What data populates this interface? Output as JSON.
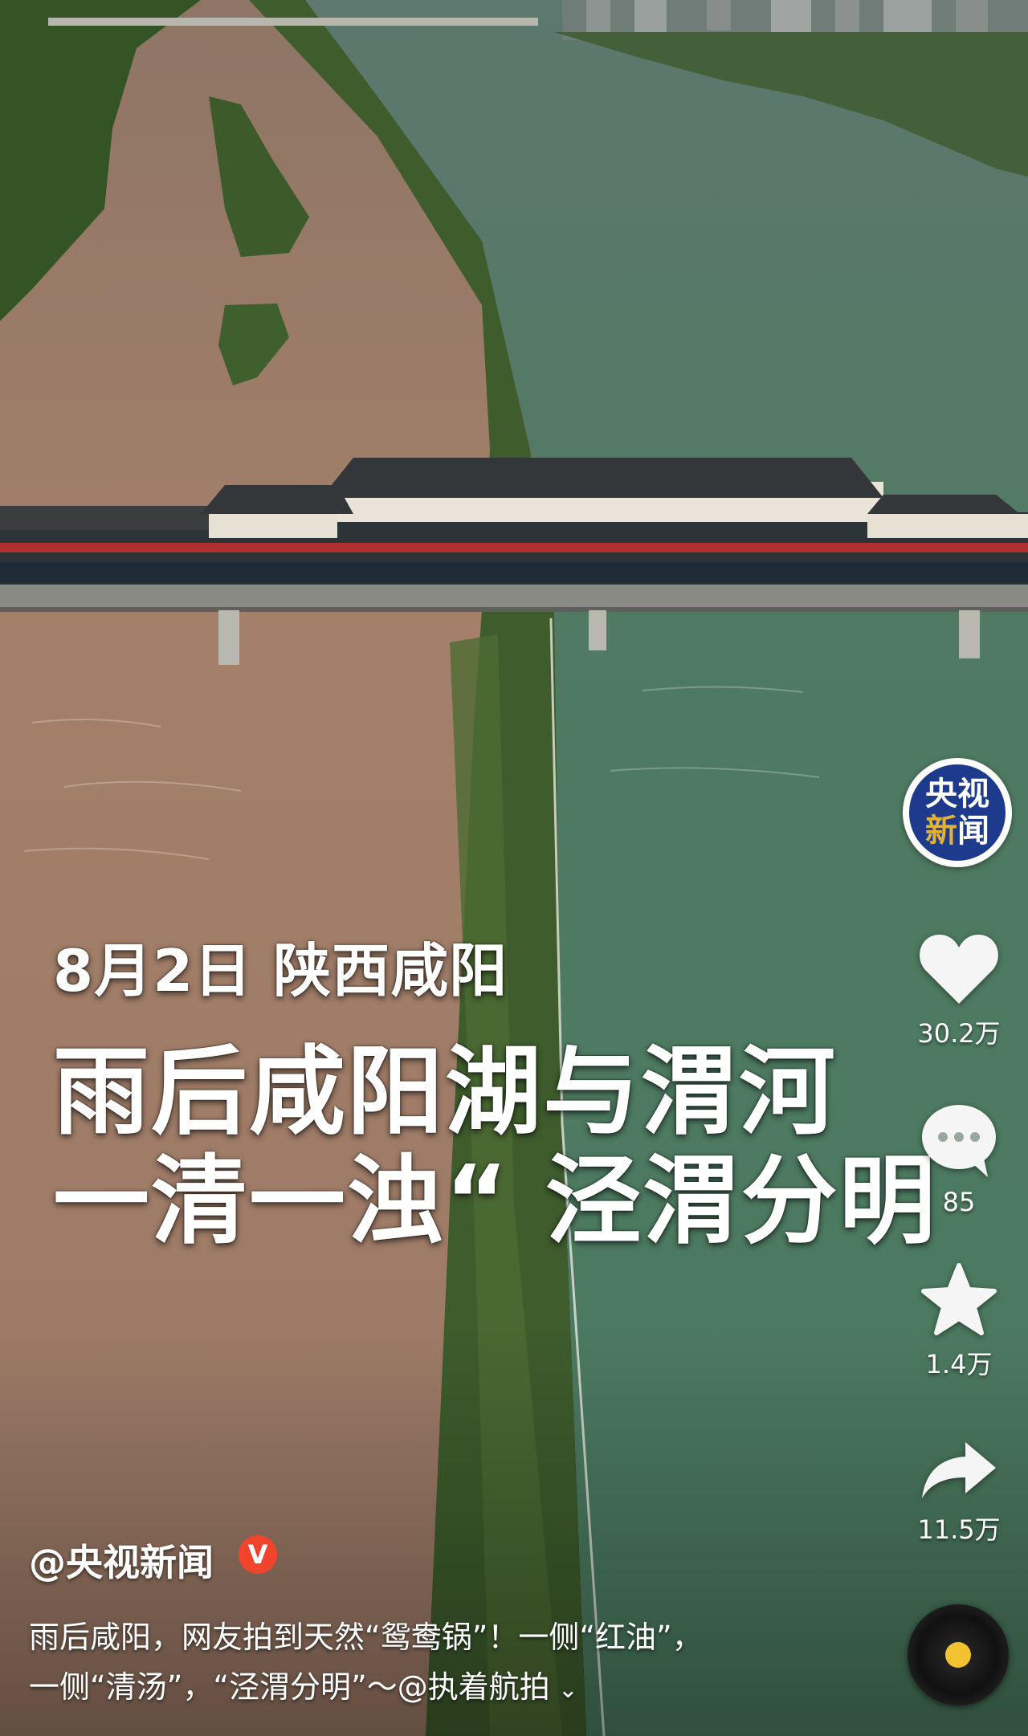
{
  "video": {
    "date_location": "8月2日 陕西咸阳",
    "headline_line1": "雨后咸阳湖与渭河",
    "headline_line2": "一清一浊“ 泾渭分明"
  },
  "channel_avatar": {
    "line1": "央视",
    "line2_a": "新",
    "line2_b": "闻"
  },
  "actions": {
    "like_count": "30.2万",
    "comment_count": "85",
    "favorite_count": "1.4万",
    "share_count": "11.5万"
  },
  "author": {
    "name": "@央视新闻",
    "verified_badge": "V"
  },
  "caption": {
    "line1": "雨后咸阳，网友拍到天然“鸳鸯锅”！一侧“红油”，",
    "line2": "一侧“清汤”，“泾渭分明”～@执着航拍",
    "expand_icon": "⌄"
  },
  "colors": {
    "muddy_river": "#9c7a63",
    "clear_lake": "#4f7f63",
    "greenery": "#3d5a2c",
    "avatar_blue": "#1d3a8c",
    "verified_red": "#f0442c",
    "disc_center": "#f2c230"
  }
}
